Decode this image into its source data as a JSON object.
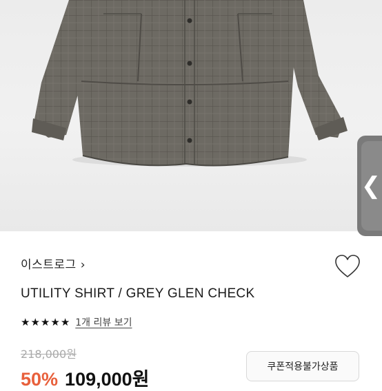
{
  "product": {
    "brand": "이스트로그",
    "brand_chevron": "›",
    "title": "UTILITY SHIRT / GREY GLEN CHECK",
    "rating": 5,
    "rating_max": 5,
    "review_link": "1개 리뷰 보기",
    "original_price": "218,000원",
    "discount": "50%",
    "sale_price": "109,000원",
    "coupon_label": "쿠폰적용불가상품"
  },
  "ui": {
    "side_tab_glyph": "❮",
    "heart_icon": "heart-outline-icon",
    "star_icon": "star-filled-icon",
    "discount_color": "#e8603c"
  }
}
